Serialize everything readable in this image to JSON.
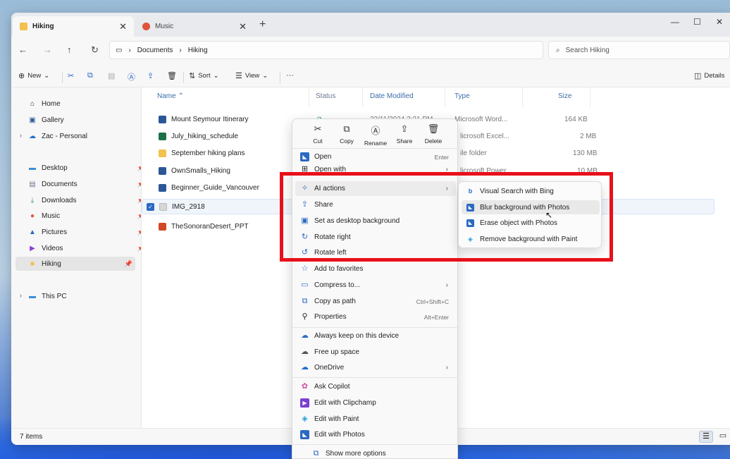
{
  "tabs": [
    {
      "label": "Hiking",
      "close": "✕"
    },
    {
      "label": "Music",
      "close": "✕"
    }
  ],
  "window_controls": {
    "minimize": "—",
    "maximize": "☐",
    "close": "✕"
  },
  "nav": {
    "back": "←",
    "forward": "→",
    "up": "↑",
    "refresh": "↻"
  },
  "address": {
    "segments": [
      "Documents",
      "Hiking"
    ],
    "separator": "›"
  },
  "search": {
    "placeholder": "Search Hiking"
  },
  "toolbar": {
    "new": "New",
    "sort": "Sort",
    "view": "View",
    "more": "···",
    "details": "Details"
  },
  "sidebar": {
    "items": [
      {
        "label": "Home"
      },
      {
        "label": "Gallery"
      },
      {
        "label": "Zac - Personal"
      },
      {
        "label": "Desktop"
      },
      {
        "label": "Documents"
      },
      {
        "label": "Downloads"
      },
      {
        "label": "Music"
      },
      {
        "label": "Pictures"
      },
      {
        "label": "Videos"
      },
      {
        "label": "Hiking"
      },
      {
        "label": "This PC"
      }
    ]
  },
  "columns": {
    "name": "Name",
    "status": "Status",
    "date": "Date Modified",
    "type": "Type",
    "size": "Size"
  },
  "files": [
    {
      "name": "Mount Seymour Itinerary",
      "date": "23/11/2024 3:21 PM",
      "type": "Microsoft Word...",
      "size": "164 KB",
      "color": "#2b5797"
    },
    {
      "name": "July_hiking_schedule",
      "type": "licrosoft Excel...",
      "size": "2 MB",
      "color": "#1e7145"
    },
    {
      "name": "September hiking plans",
      "type": "ile folder",
      "size": "130 MB",
      "color": "#f2c14e"
    },
    {
      "name": "OwnSmalls_Hiking",
      "type": "licrosoft Power...",
      "size": "10 MB",
      "color": "#2b5797"
    },
    {
      "name": "Beginner_Guide_Vancouver",
      "color": "#2b5797"
    },
    {
      "name": "IMG_2918",
      "color": "#d6d6d6"
    },
    {
      "name": "TheSonoranDesert_PPT",
      "color": "#d24726"
    }
  ],
  "status": {
    "items": "7 items"
  },
  "context_menu": {
    "quick_actions": [
      {
        "label": "Cut",
        "icon": "✂"
      },
      {
        "label": "Copy",
        "icon": "⧉"
      },
      {
        "label": "Rename",
        "icon": "Ⓐ"
      },
      {
        "label": "Share",
        "icon": "⇪"
      },
      {
        "label": "Delete",
        "icon": "🗑"
      }
    ],
    "items": [
      {
        "label": "Open",
        "accel": "Enter"
      },
      {
        "label": "Open with"
      },
      {
        "label": "AI actions"
      },
      {
        "label": "Share"
      },
      {
        "label": "Set as desktop background"
      },
      {
        "label": "Rotate right"
      },
      {
        "label": "Rotate left"
      },
      {
        "label": "Add to favorites"
      },
      {
        "label": "Compress to..."
      },
      {
        "label": "Copy as path",
        "accel": "Ctrl+Shift+C"
      },
      {
        "label": "Properties",
        "accel": "Alt+Enter"
      },
      {
        "label": "Always keep on this device"
      },
      {
        "label": "Free up space"
      },
      {
        "label": "OneDrive"
      },
      {
        "label": "Ask Copilot"
      },
      {
        "label": "Edit with Clipchamp"
      },
      {
        "label": "Edit with Paint"
      },
      {
        "label": "Edit with Photos"
      },
      {
        "label": "Show more options"
      }
    ]
  },
  "ai_submenu": {
    "items": [
      {
        "label": "Visual Search with Bing"
      },
      {
        "label": "Blur background with Photos"
      },
      {
        "label": "Erase object with Photos"
      },
      {
        "label": "Remove background with Paint"
      }
    ]
  },
  "colors": {
    "highlight": "#e8101a",
    "accent": "#2b69c2"
  }
}
